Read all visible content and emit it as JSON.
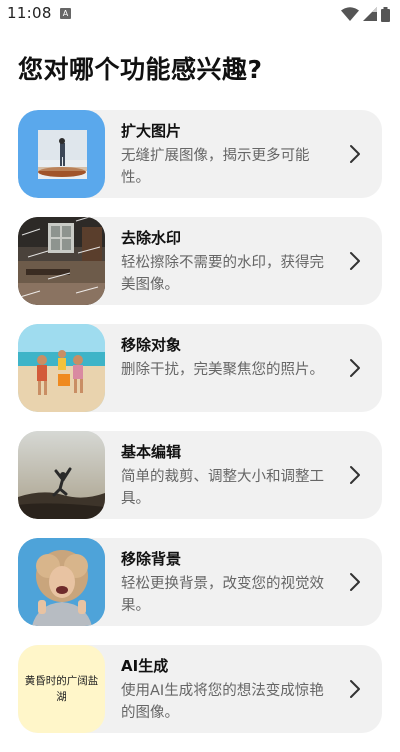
{
  "status_bar": {
    "time": "11:08",
    "sim_icon": "A",
    "icons": [
      "wifi-icon",
      "signal-icon",
      "battery-icon"
    ]
  },
  "page": {
    "title": "您对哪个功能感兴趣?"
  },
  "features": [
    {
      "title": "扩大图片",
      "description": "无缝扩展图像，揭示更多可能性。",
      "thumb": "expand-image-thumbnail"
    },
    {
      "title": "去除水印",
      "description": "轻松擦除不需要的水印，获得完美图像。",
      "thumb": "watermark-room-thumbnail"
    },
    {
      "title": "移除对象",
      "description": "删除干扰，完美聚焦您的照片。",
      "thumb": "beach-kids-thumbnail"
    },
    {
      "title": "基本编辑",
      "description": "简单的裁剪、调整大小和调整工具。",
      "thumb": "jumping-person-thumbnail"
    },
    {
      "title": "移除背景",
      "description": "轻松更换背景，改变您的视觉效果。",
      "thumb": "laughing-woman-thumbnail"
    },
    {
      "title": "AI生成",
      "description": "使用AI生成将您的想法变成惊艳的图像。",
      "thumb": "ai-text-thumbnail",
      "thumb_text": "黄昏时的广阔盐湖"
    }
  ],
  "colors": {
    "card_bg": "#f1f1f1",
    "blue_thumb_bg": "#5aa8ec",
    "ai_thumb_bg": "#fff6c9"
  }
}
